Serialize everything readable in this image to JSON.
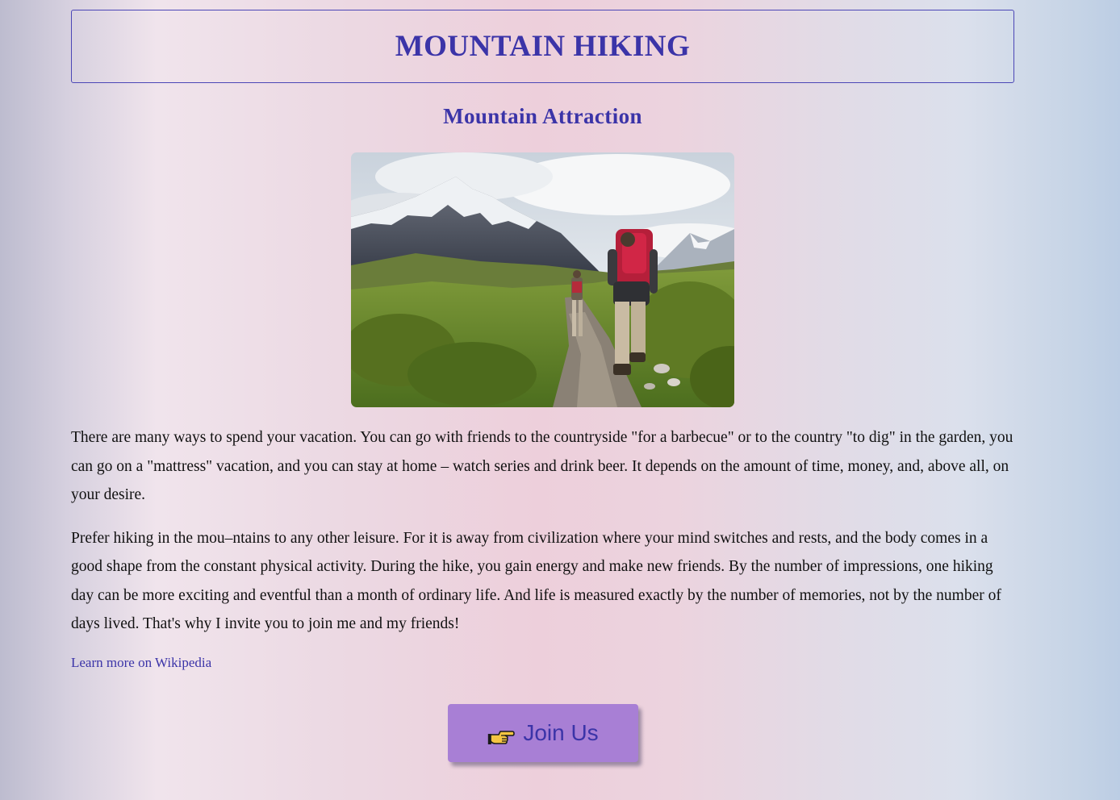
{
  "header": {
    "title": "MOUNTAIN HIKING"
  },
  "section": {
    "title": "Mountain Attraction"
  },
  "photo": {
    "description_alt": "Two hikers with backpacks walking on a mountain trail"
  },
  "content": {
    "paragraphs": [
      "There are many ways to spend your vacation. You can go with friends to the countryside \"for a barbecue\" or to the country \"to dig\" in the garden, you can go on a \"mattress\" vacation, and you can stay at home – watch series and drink beer. It depends on the amount of time, money, and, above all, on your desire.",
      "Prefer hiking in the mou–ntains to any other leisure. For it is away from civilization where your mind switches and rests, and the body comes in a good shape from the constant physical activity. During the hike, you gain energy and make new friends. By the number of impressions, one hiking day can be more exciting and eventful than a month of ordinary life. And life is measured exactly by the number of memories, not by the number of days lived. That's why I invite you to join me and my friends!"
    ],
    "link_label": "Learn more on Wikipedia"
  },
  "cta": {
    "label": "Join Us",
    "icon": "pointing-hand-icon"
  },
  "colors": {
    "accent": "#3b34a8",
    "button": "#a87fd5"
  }
}
